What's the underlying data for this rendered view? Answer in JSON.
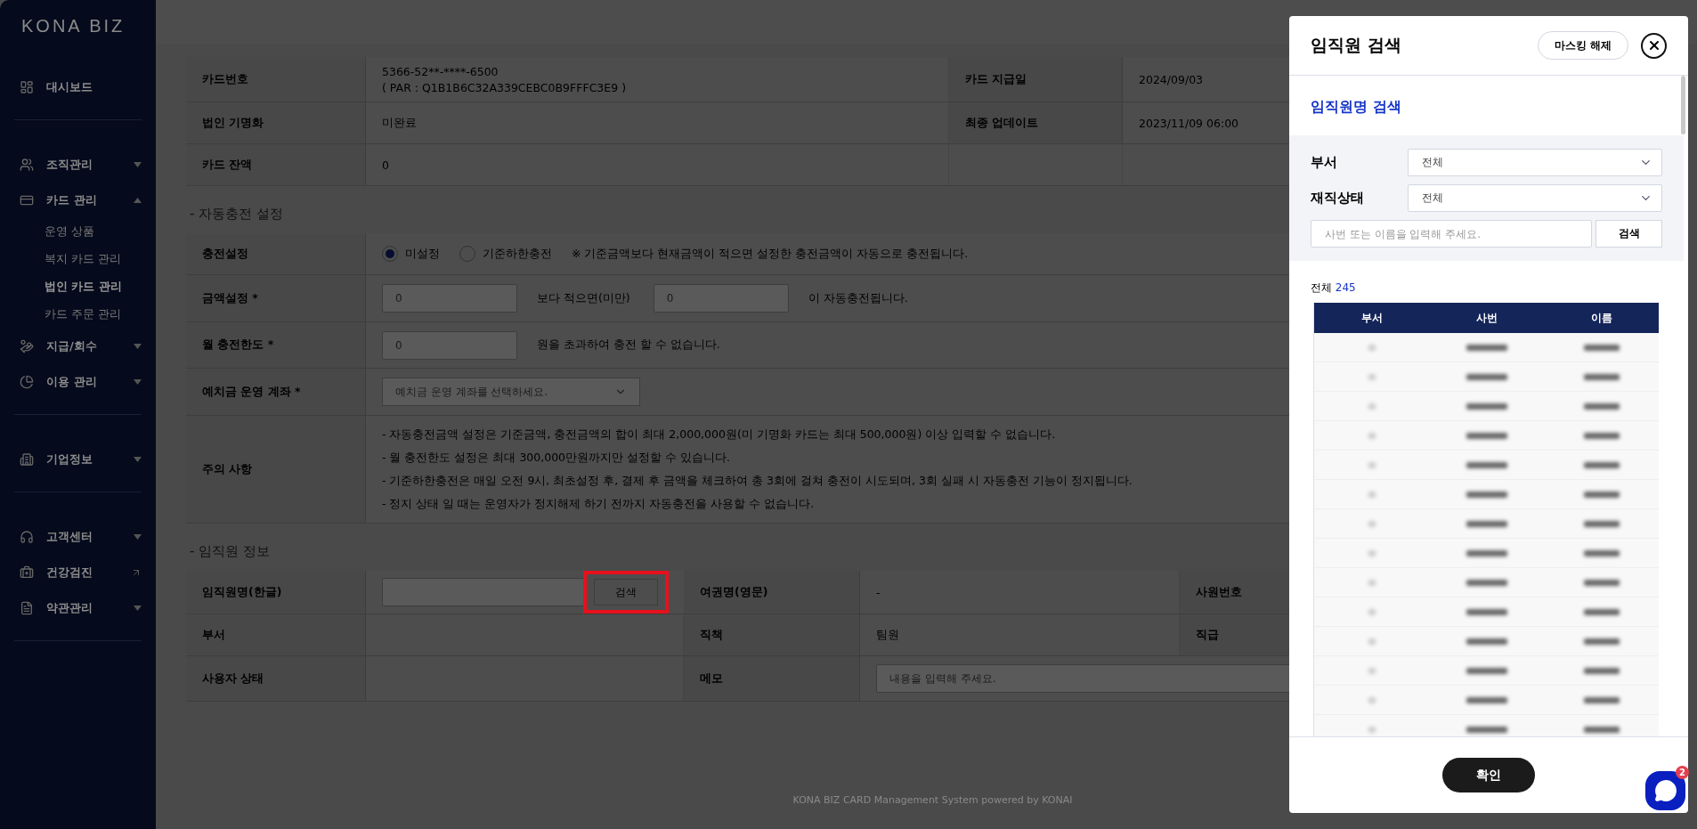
{
  "sidebar": {
    "logo": "KONA BIZ",
    "sections": [
      [
        {
          "kind": "link",
          "label": "대시보드"
        }
      ],
      [
        {
          "kind": "group",
          "label": "조직관리",
          "expanded": false
        },
        {
          "kind": "group",
          "label": "카드 관리",
          "expanded": true,
          "children": [
            {
              "label": "운영 상품",
              "selected": false
            },
            {
              "label": "복지 카드 관리",
              "selected": false
            },
            {
              "label": "법인 카드 관리",
              "selected": true
            },
            {
              "label": "카드 주문 관리",
              "selected": false
            }
          ]
        },
        {
          "kind": "group",
          "label": "지급/회수",
          "expanded": false
        },
        {
          "kind": "group",
          "label": "이용 관리",
          "expanded": false
        }
      ],
      [
        {
          "kind": "group",
          "label": "기업정보",
          "expanded": false
        }
      ],
      [
        {
          "kind": "group",
          "label": "고객센터",
          "expanded": false
        },
        {
          "kind": "external",
          "label": "건강검진"
        },
        {
          "kind": "group",
          "label": "약관관리",
          "expanded": false
        }
      ]
    ]
  },
  "card_info": {
    "rows": [
      {
        "label": "카드번호",
        "value": "5366-52**-****-6500",
        "sub_value": "( PAR : Q1B1B6C32A339CEBC0B9FFFC3E9 )",
        "label_2": "카드 지급일",
        "value_2": "2024/09/03"
      },
      {
        "label": "법인 기명화",
        "value": "미완료",
        "label_2": "최종 업데이트",
        "value_2": "2023/11/09 06:00"
      },
      {
        "label": "카드 잔액",
        "value": "0"
      }
    ]
  },
  "auto_charge": {
    "title": "- 자동충전 설정",
    "rows": [
      {
        "kind": "radio",
        "label": "충전설정",
        "options": [
          {
            "label": "미설정",
            "selected": true
          },
          {
            "label": "기준하한충전",
            "selected": false
          }
        ],
        "note": "※ 기준금액보다 현재금액이 적으면 설정한 충전금액이 자동으로 충전됩니다."
      },
      {
        "kind": "amounts",
        "label": "금액설정 *",
        "placeholder_1": "0",
        "middle": "보다 적으면(미만)",
        "placeholder_2": "0",
        "suffix": "이 자동충전됩니다."
      },
      {
        "kind": "amount",
        "label": "월 충전한도 *",
        "placeholder_1": "0",
        "suffix": "원을 초과하여 충전 할 수 없습니다."
      },
      {
        "kind": "select",
        "label": "예치금 운영 계좌 *",
        "placeholder": "예치금 운영 계좌를 선택하세요."
      },
      {
        "kind": "notes",
        "label": "주의 사항",
        "lines": [
          "- 자동충전금액 설정은 기준금액, 충전금액의 합이 최대 2,000,000원(미 기명화 카드는 최대 500,000원) 이상 입력할 수 없습니다.",
          "- 월 충전한도 설정은 최대 300,000만원까지만 설정할 수 있습니다.",
          "- 기준하한충전은 매일 오전 9시, 최초설정 후, 결제 후 금액을 체크하여 총 3회에 걸쳐 충전이 시도되며, 3회 실패 시 자동충전 기능이 정지됩니다.",
          "- 정지 상태 일 때는 운영자가 정지해제 하기 전까지 자동충전을 사용할 수 없습니다."
        ]
      }
    ]
  },
  "employee": {
    "title": "- 임직원 정보",
    "name_label": "임직원명(한글)",
    "search_button": "검색",
    "search_highlighted": true,
    "passport_label": "여권명(영문)",
    "passport_value": "-",
    "emp_no_label": "사원번호",
    "dept_label": "부서",
    "position_label": "직책",
    "position_value": "팀원",
    "rank_label": "직급",
    "status_label": "사용자 상태",
    "memo_label": "메모",
    "memo_placeholder": "내용을 입력해 주세요."
  },
  "footer": "KONA BIZ CARD Management System powered by KONAI",
  "panel": {
    "title": "임직원 검색",
    "unmask_button": "마스킹 해제",
    "section_title": "임직원명 검색",
    "filters": [
      {
        "label": "부서",
        "value": "전체"
      },
      {
        "label": "재직상태",
        "value": "전체"
      }
    ],
    "search_placeholder": "사번 또는 이름을 입력해 주세요.",
    "search_button": "검색",
    "total_label": "전체",
    "total_count": "245",
    "columns": [
      "부서",
      "사번",
      "이름"
    ],
    "confirm_button": "확인"
  },
  "chat_badge": "2"
}
